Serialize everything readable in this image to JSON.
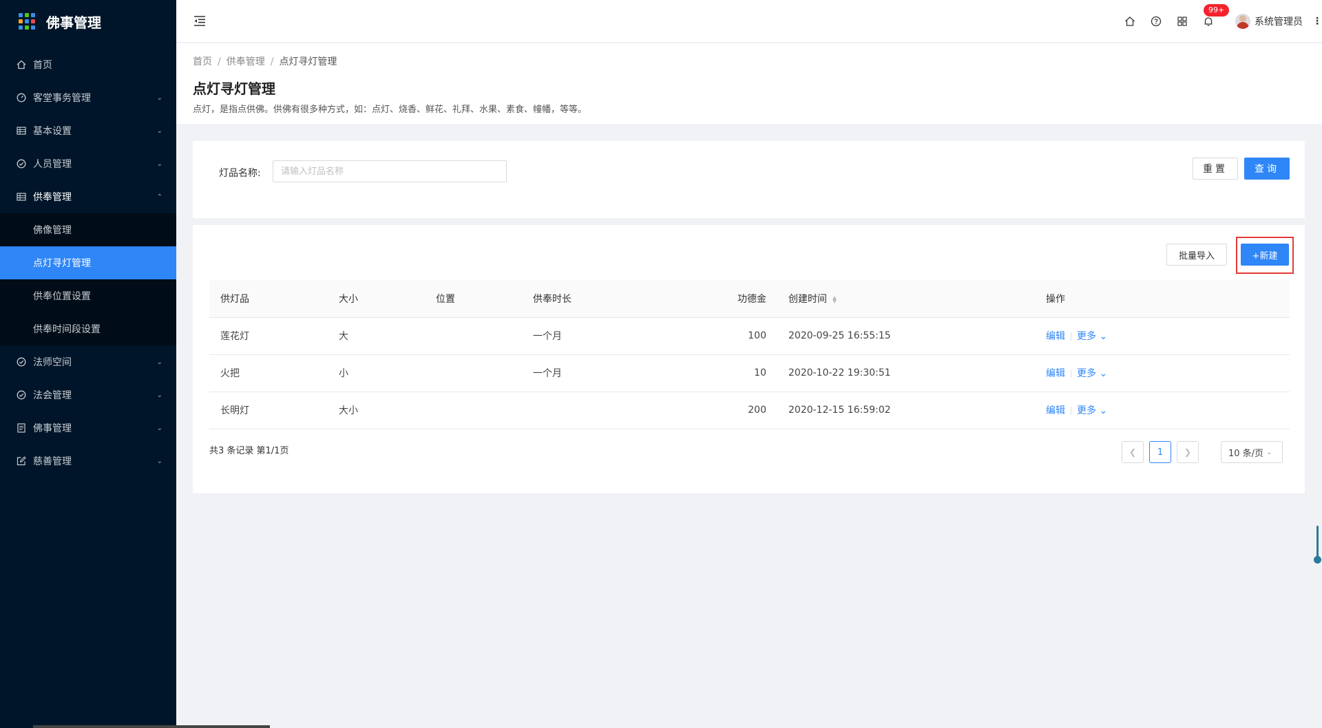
{
  "app": {
    "title": "佛事管理"
  },
  "sidebar": {
    "items": [
      {
        "label": "首页",
        "icon": "home-icon"
      },
      {
        "label": "客堂事务管理",
        "icon": "dashboard-icon"
      },
      {
        "label": "基本设置",
        "icon": "table-icon"
      },
      {
        "label": "人员管理",
        "icon": "check-circle-icon"
      },
      {
        "label": "供奉管理",
        "icon": "table-icon"
      },
      {
        "label": "法师空间",
        "icon": "check-circle-icon"
      },
      {
        "label": "法会管理",
        "icon": "check-circle-icon"
      },
      {
        "label": "佛事管理",
        "icon": "file-icon"
      },
      {
        "label": "慈善管理",
        "icon": "edit-icon"
      }
    ],
    "sub": [
      {
        "label": "佛像管理"
      },
      {
        "label": "点灯寻灯管理"
      },
      {
        "label": "供奉位置设置"
      },
      {
        "label": "供奉时间段设置"
      }
    ]
  },
  "header": {
    "notification_count": "99+",
    "username": "系统管理员"
  },
  "breadcrumb": {
    "home": "首页",
    "parent": "供奉管理",
    "current": "点灯寻灯管理"
  },
  "page": {
    "title": "点灯寻灯管理",
    "description": "点灯，是指点供佛。供佛有很多种方式，如：点灯、烧香、鲜花、礼拜、水果、素食、幢幡，等等。"
  },
  "search": {
    "label": "灯品名称:",
    "placeholder": "请输入灯品名称",
    "reset_label": "重置",
    "query_label": "查询"
  },
  "toolbar": {
    "import_label": "批量导入",
    "new_label": "+新建"
  },
  "table": {
    "headers": [
      "供灯品",
      "大小",
      "位置",
      "供奉时长",
      "功德金",
      "创建时间",
      "操作"
    ],
    "rows": [
      {
        "name": "莲花灯",
        "size": "大",
        "position": "",
        "duration": "一个月",
        "amount": "100",
        "created": "2020-09-25 16:55:15"
      },
      {
        "name": "火把",
        "size": "小",
        "position": "",
        "duration": "一个月",
        "amount": "10",
        "created": "2020-10-22 19:30:51"
      },
      {
        "name": "长明灯",
        "size": "大小",
        "position": "",
        "duration": "",
        "amount": "200",
        "created": "2020-12-15 16:59:02"
      }
    ],
    "edit_label": "编辑",
    "more_label": "更多"
  },
  "pagination": {
    "summary": "共3 条记录 第1/1页",
    "current_page": "1",
    "page_size": "10 条/页"
  },
  "colors": {
    "sidebar_bg": "#001529",
    "primary": "#2f86f6",
    "highlight": "#e53935"
  }
}
